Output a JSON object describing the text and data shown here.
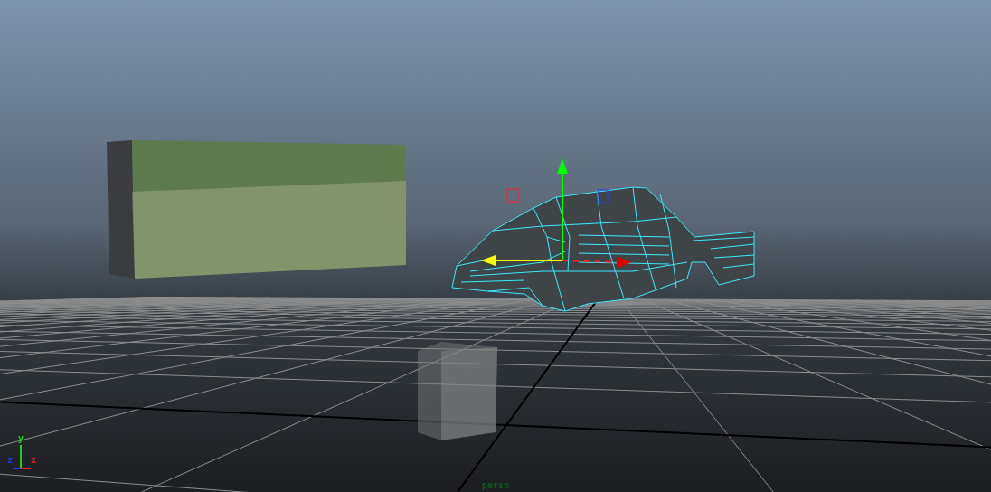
{
  "viewport": {
    "camera": "persp",
    "axis_labels": [
      {
        "text": "y",
        "color": "#22cc22"
      },
      {
        "text": "z",
        "color": "#2233ff"
      },
      {
        "text": "x",
        "color": "#ee2222"
      }
    ]
  }
}
